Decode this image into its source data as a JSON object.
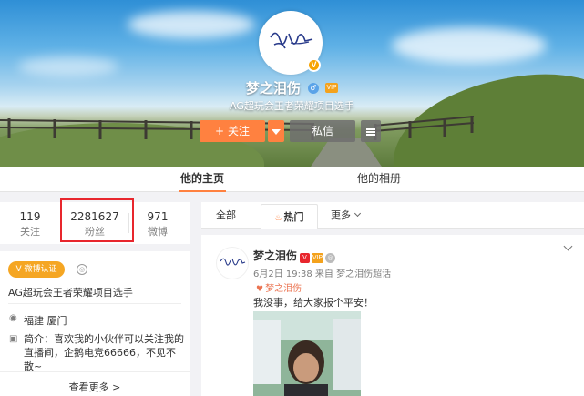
{
  "profile": {
    "name": "梦之泪伤",
    "description": "AG超玩会王者荣耀项目选手",
    "avatar_text": "V"
  },
  "actions": {
    "follow_label": "关注",
    "follow_icon": "+",
    "message_label": "私信"
  },
  "tabs": {
    "home": "他的主页",
    "album": "他的相册"
  },
  "stats": [
    {
      "value": "119",
      "label": "关注"
    },
    {
      "value": "2281627",
      "label": "粉丝"
    },
    {
      "value": "971",
      "label": "微博"
    }
  ],
  "info": {
    "verified_badge": "微博认证",
    "title": "AG超玩会王者荣耀项目选手",
    "location": "福建 厦门",
    "bio": "简介：喜欢我的小伙伴可以关注我的直播间，企鹅电竞66666，不见不散~",
    "more": "查看更多 >"
  },
  "feed_filters": {
    "all": "全部",
    "hot": "热门",
    "more": "更多"
  },
  "post": {
    "author": "梦之泪伤",
    "meta": "6月2日 19:38 来自 梦之泪伤超话",
    "topic": "梦之泪伤",
    "text": "我没事，给大家报个平安！"
  },
  "colors": {
    "accent": "#ff8140",
    "highlight_box": "#e8262d",
    "verified": "#f5a623"
  }
}
